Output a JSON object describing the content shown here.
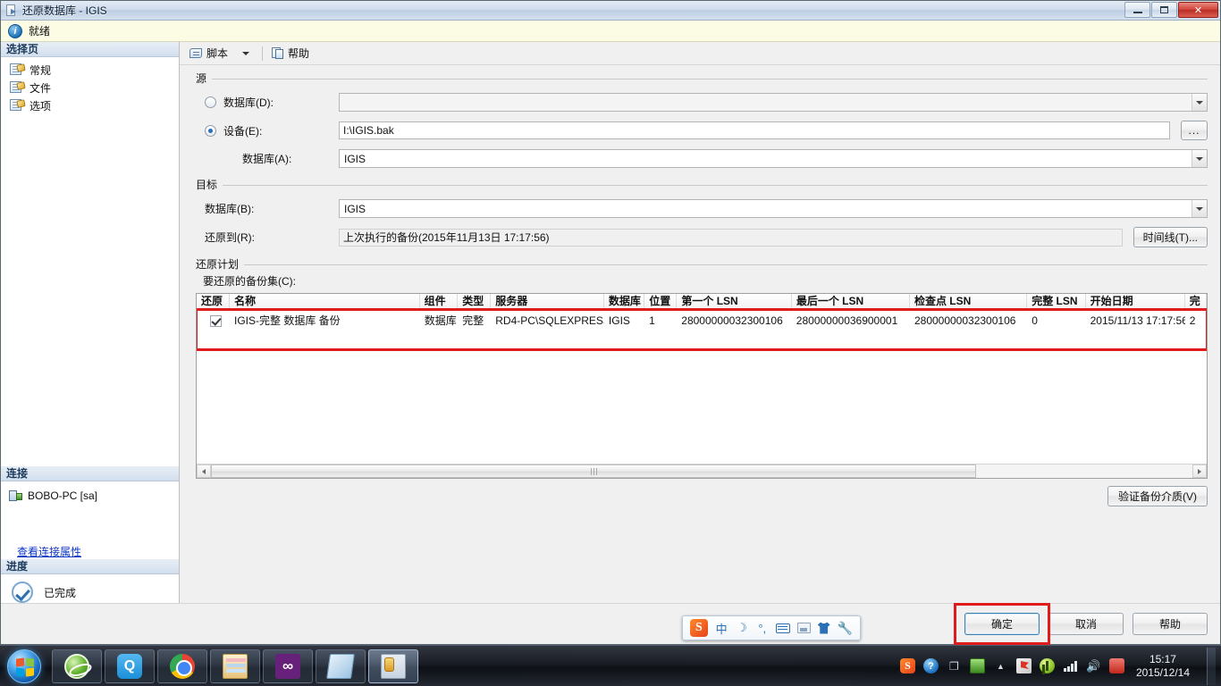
{
  "window": {
    "title": "还原数据库 - IGIS",
    "icon": "restore-database-icon",
    "minimize_label": "",
    "maximize_label": "",
    "close_label": "✕"
  },
  "status_strip": {
    "icon": "info-icon",
    "glyph": "i",
    "text": "就绪"
  },
  "sidebar": {
    "section_title": "选择页",
    "items": [
      {
        "label": "常规",
        "icon": "page-icon"
      },
      {
        "label": "文件",
        "icon": "page-icon"
      },
      {
        "label": "选项",
        "icon": "page-icon"
      }
    ],
    "connection": {
      "section_title": "连接",
      "server": "BOBO-PC [sa]",
      "server_icon": "server-icon",
      "view_properties_link": "查看连接属性"
    },
    "progress": {
      "section_title": "进度",
      "icon": "check-circle-icon",
      "text": "已完成"
    }
  },
  "toolbar": {
    "script_label": "脚本",
    "script_icon": "script-icon",
    "dropdown_icon": "chevron-down-icon",
    "help_label": "帮助",
    "help_icon": "help-page-icon"
  },
  "source": {
    "group_title": "源",
    "database_radio_label": "数据库(D):",
    "database_radio_selected": false,
    "database_value": "",
    "device_radio_label": "设备(E):",
    "device_radio_selected": true,
    "device_value": "I:\\IGIS.bak",
    "browse_button_label": "...",
    "db_label": "数据库(A):",
    "db_value": "IGIS"
  },
  "target": {
    "group_title": "目标",
    "database_label": "数据库(B):",
    "database_value": "IGIS",
    "restore_to_label": "还原到(R):",
    "restore_to_value": "上次执行的备份(2015年11月13日 17:17:56)",
    "timeline_button_label": "时间线(T)..."
  },
  "restore_plan": {
    "group_title": "还原计划",
    "grid_label": "要还原的备份集(C):",
    "columns": [
      "还原",
      "名称",
      "组件",
      "类型",
      "服务器",
      "数据库",
      "位置",
      "第一个 LSN",
      "最后一个 LSN",
      "检查点 LSN",
      "完整 LSN",
      "开始日期",
      "完"
    ],
    "rows": [
      {
        "restore_checked": true,
        "name": "IGIS-完整 数据库 备份",
        "component": "数据库",
        "type": "完整",
        "server": "RD4-PC\\SQLEXPRESS",
        "database": "IGIS",
        "position": "1",
        "first_lsn": "28000000032300106",
        "last_lsn": "28000000036900001",
        "checkpoint_lsn": "28000000032300106",
        "full_lsn": "0",
        "start_date": "2015/11/13 17:17:56",
        "trailing": "2"
      }
    ],
    "verify_button_label": "验证备份介质(V)"
  },
  "footer": {
    "ok_label": "确定",
    "cancel_label": "取消",
    "help_label": "帮助"
  },
  "highlights": {
    "accent_color": "#e01b1b",
    "grid_row_box": "红框标注备份集行",
    "ok_button_box": "红框标注确定按钮"
  },
  "ime_bar": {
    "logo": "sogou-logo",
    "logo_text": "S",
    "mode": "中",
    "moon_icon": "moon-icon",
    "punct_icon": "°,",
    "keyboard_icon": "keyboard-icon",
    "toolbox_icon": "toolbox-icon",
    "skin_icon": "skin-shirt-icon",
    "wrench_icon": "wrench-icon",
    "moon_glyph": "☽",
    "wrench_glyph": "🔧"
  },
  "taskbar": {
    "start_button": "start-orb",
    "items": [
      {
        "name": "ie-browser",
        "icon": "ie-icon"
      },
      {
        "name": "qq-messenger",
        "icon": "qq-icon"
      },
      {
        "name": "google-chrome",
        "icon": "chrome-icon"
      },
      {
        "name": "file-explorer",
        "icon": "folder-icon"
      },
      {
        "name": "visual-studio",
        "icon": "vs-icon"
      },
      {
        "name": "notepad-app",
        "icon": "note-icon"
      },
      {
        "name": "sql-server-management-studio",
        "icon": "sql-icon"
      }
    ],
    "tray": [
      {
        "name": "sogou-tray",
        "glyph": "S"
      },
      {
        "name": "help-tray",
        "glyph": "?"
      },
      {
        "name": "window-tray",
        "glyph": "❐"
      },
      {
        "name": "show-hidden-tray",
        "glyph": "▲"
      },
      {
        "name": "battery-tray",
        "glyph": ""
      },
      {
        "name": "flag-tray",
        "glyph": ""
      },
      {
        "name": "shield-tray",
        "glyph": ""
      },
      {
        "name": "network-tray",
        "glyph": ""
      },
      {
        "name": "volume-tray",
        "glyph": "🔊"
      },
      {
        "name": "alert-tray",
        "glyph": ""
      }
    ],
    "clock": {
      "time": "15:17",
      "date": "2015/12/14"
    }
  }
}
